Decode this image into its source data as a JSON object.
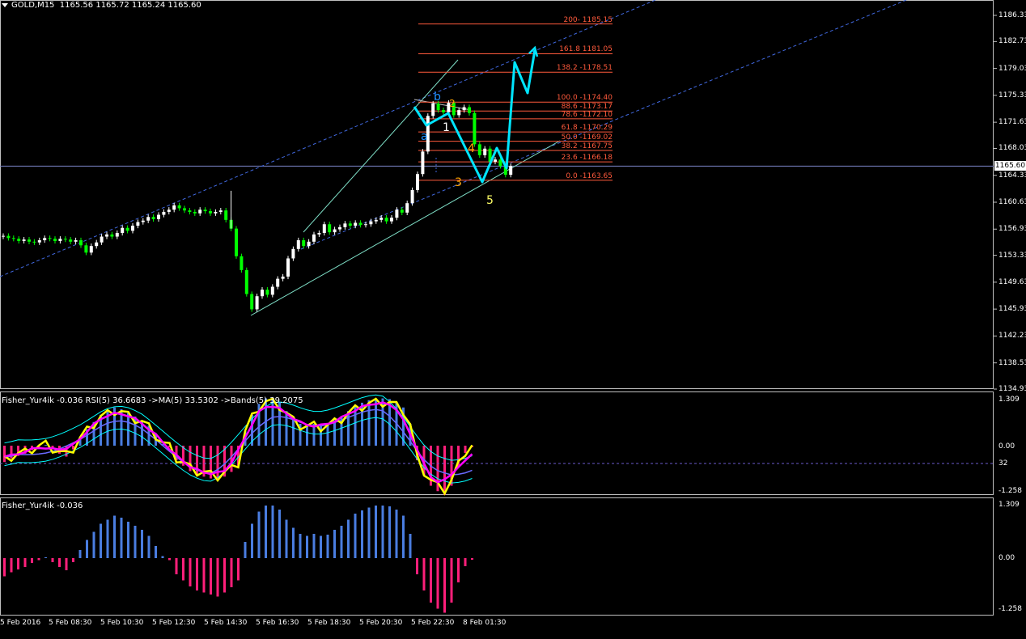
{
  "window": {
    "symbol_label": "GOLD,M15",
    "ohlc_text": "1165.56 1165.72 1165.24 1165.60",
    "dropdown_icon": "triangle-down-icon"
  },
  "colors": {
    "background": "#000000",
    "bull_candle": "#ffffff",
    "bear_candle": "#00ff00",
    "channel_dash": "#4169e1",
    "fib": "#ff5a3c",
    "projection": "#00e5ff",
    "hist_pos": "#4a7de0",
    "hist_neg": "#ff1f7a",
    "rsi": "#ffff00",
    "ma": "#ff00ff",
    "band": "#00ffff"
  },
  "main_chart": {
    "current_price": "1165.60",
    "y_ticks": [
      "1186.33",
      "1182.73",
      "1179.03",
      "1175.33",
      "1171.63",
      "1168.03",
      "1164.33",
      "1160.63",
      "1156.93",
      "1153.33",
      "1149.63",
      "1145.93",
      "1142.23",
      "1138.53",
      "1134.93"
    ],
    "fib_levels": [
      {
        "ratio": "200-",
        "price": "1185.15",
        "text": "200- 1185.15"
      },
      {
        "ratio": "161.8",
        "price": "1181.05",
        "text": "161.8 1181.05"
      },
      {
        "ratio": "138.2",
        "price": "1178.51",
        "text": "138.2 -1178.51"
      },
      {
        "ratio": "100.0",
        "price": "1174.40",
        "text": "100.0 -1174.40"
      },
      {
        "ratio": "88.6",
        "price": "1173.17",
        "text": "88.6 -1173.17"
      },
      {
        "ratio": "78.6",
        "price": "1172.10",
        "text": "78.6 -1172.10"
      },
      {
        "ratio": "61.8",
        "price": "1170.29",
        "text": "61.8 -1170.29"
      },
      {
        "ratio": "50.0",
        "price": "1169.02",
        "text": "50.0 -1169.02"
      },
      {
        "ratio": "38.2",
        "price": "1167.75",
        "text": "38.2 -1167.75"
      },
      {
        "ratio": "23.6",
        "price": "1166.18",
        "text": "23.6 -1166.18"
      },
      {
        "ratio": "0.0",
        "price": "1163.65",
        "text": "0.0 -1163.65"
      }
    ],
    "wave_labels": [
      {
        "text": "b",
        "color": "#1e90ff"
      },
      {
        "text": "2",
        "color": "#ffa500"
      },
      {
        "text": "a",
        "color": "#1e90ff"
      },
      {
        "text": "1",
        "color": "#ffffff"
      },
      {
        "text": "4",
        "color": "#ffa500"
      },
      {
        "text": "3",
        "color": "#ffa500"
      },
      {
        "text": "5",
        "color": "#ffff66"
      }
    ],
    "candles": [
      [
        1155.9,
        1156.0
      ],
      [
        1156.0,
        1155.7
      ],
      [
        1155.7,
        1155.6
      ],
      [
        1155.6,
        1155.3
      ],
      [
        1155.3,
        1155.5
      ],
      [
        1155.5,
        1155.2
      ],
      [
        1155.2,
        1155.1
      ],
      [
        1155.1,
        1155.4
      ],
      [
        1155.4,
        1155.7
      ],
      [
        1155.7,
        1155.6
      ],
      [
        1155.6,
        1155.3
      ],
      [
        1155.3,
        1155.6
      ],
      [
        1155.6,
        1155.5
      ],
      [
        1155.5,
        1155.2
      ],
      [
        1155.2,
        1155.4
      ],
      [
        1155.4,
        1154.7
      ],
      [
        1154.7,
        1153.7
      ],
      [
        1153.7,
        1154.6
      ],
      [
        1154.6,
        1155.1
      ],
      [
        1155.1,
        1155.9
      ],
      [
        1155.9,
        1156.2
      ],
      [
        1156.2,
        1155.9
      ],
      [
        1155.9,
        1156.4
      ],
      [
        1156.4,
        1157.1
      ],
      [
        1157.1,
        1156.7
      ],
      [
        1156.7,
        1157.4
      ],
      [
        1157.4,
        1157.9
      ],
      [
        1157.9,
        1158.1
      ],
      [
        1158.1,
        1158.6
      ],
      [
        1158.6,
        1158.3
      ],
      [
        1158.3,
        1158.9
      ],
      [
        1158.9,
        1159.3
      ],
      [
        1159.3,
        1159.6
      ],
      [
        1159.6,
        1160.2
      ],
      [
        1160.2,
        1159.8
      ],
      [
        1159.8,
        1159.5
      ],
      [
        1159.5,
        1159.3
      ],
      [
        1159.3,
        1159.1
      ],
      [
        1159.1,
        1159.6
      ],
      [
        1159.6,
        1159.4
      ],
      [
        1159.4,
        1159.1
      ],
      [
        1159.1,
        1159.3
      ],
      [
        1159.3,
        1159.5
      ],
      [
        1159.5,
        1158.2
      ],
      [
        1158.2,
        1157.0
      ],
      [
        1157.0,
        1153.2
      ],
      [
        1153.2,
        1151.3
      ],
      [
        1151.3,
        1148.0
      ],
      [
        1148.0,
        1145.9
      ],
      [
        1145.9,
        1147.7
      ],
      [
        1147.7,
        1148.6
      ],
      [
        1148.6,
        1147.9
      ],
      [
        1147.9,
        1149.0
      ],
      [
        1149.0,
        1150.1
      ],
      [
        1150.1,
        1150.4
      ],
      [
        1150.4,
        1152.9
      ],
      [
        1152.9,
        1154.2
      ],
      [
        1154.2,
        1155.4
      ],
      [
        1155.4,
        1154.6
      ],
      [
        1154.6,
        1155.2
      ],
      [
        1155.2,
        1156.2
      ],
      [
        1156.2,
        1156.4
      ],
      [
        1156.4,
        1157.6
      ],
      [
        1157.6,
        1156.5
      ],
      [
        1156.5,
        1156.9
      ],
      [
        1156.9,
        1157.2
      ],
      [
        1157.2,
        1157.7
      ],
      [
        1157.7,
        1157.4
      ],
      [
        1157.4,
        1157.8
      ],
      [
        1157.8,
        1157.5
      ],
      [
        1157.5,
        1157.6
      ],
      [
        1157.6,
        1158.0
      ],
      [
        1158.0,
        1158.2
      ],
      [
        1158.2,
        1158.5
      ],
      [
        1158.5,
        1158.0
      ],
      [
        1158.0,
        1158.5
      ],
      [
        1158.5,
        1159.6
      ],
      [
        1159.6,
        1159.2
      ],
      [
        1159.2,
        1160.5
      ],
      [
        1160.5,
        1162.3
      ],
      [
        1162.3,
        1164.5
      ],
      [
        1164.5,
        1167.6
      ],
      [
        1167.6,
        1172.5
      ],
      [
        1172.5,
        1174.2
      ],
      [
        1174.2,
        1173.3
      ],
      [
        1173.3,
        1173.0
      ],
      [
        1173.0,
        1174.3
      ],
      [
        1174.3,
        1172.6
      ],
      [
        1172.6,
        1173.3
      ],
      [
        1173.3,
        1173.7
      ],
      [
        1173.7,
        1172.9
      ],
      [
        1172.9,
        1168.6
      ],
      [
        1168.6,
        1167.1
      ],
      [
        1167.1,
        1168.0
      ],
      [
        1168.0,
        1166.2
      ],
      [
        1166.2,
        1166.5
      ],
      [
        1166.5,
        1165.6
      ],
      [
        1165.6,
        1164.4
      ],
      [
        1164.4,
        1165.6
      ]
    ],
    "projection": [
      [
        1173.6,
        1171.6
      ],
      [
        1173.6,
        1163.65
      ],
      [
        1170.0,
        1165.0
      ],
      [
        1179.5,
        1176.0
      ],
      [
        1181.05,
        1182.0
      ]
    ]
  },
  "indicator1": {
    "header": "Fisher_Yur4ik -0.036  RSI(5) 36.6683  ->MA(5) 33.5302  ->Bands(5) 39.2075",
    "y_ticks": [
      "1.309",
      "0.00",
      "32",
      "-1.258"
    ]
  },
  "indicator2": {
    "header": "Fisher_Yur4ik -0.036",
    "y_ticks": [
      "1.309",
      "0.00",
      "-1.258"
    ]
  },
  "fisher_values": [
    -0.45,
    -0.35,
    -0.28,
    -0.22,
    -0.12,
    -0.05,
    0.02,
    -0.1,
    -0.22,
    -0.3,
    -0.1,
    0.2,
    0.45,
    0.65,
    0.85,
    0.95,
    1.05,
    1.0,
    0.9,
    0.8,
    0.7,
    0.55,
    0.3,
    0.05,
    -0.05,
    -0.4,
    -0.55,
    -0.7,
    -0.8,
    -0.85,
    -0.9,
    -0.95,
    -0.85,
    -0.72,
    -0.55,
    0.4,
    0.85,
    1.15,
    1.3,
    1.3,
    1.2,
    0.95,
    0.75,
    0.6,
    0.55,
    0.6,
    0.55,
    0.58,
    0.7,
    0.8,
    0.95,
    1.1,
    1.18,
    1.25,
    1.3,
    1.3,
    1.28,
    1.2,
    1.05,
    0.6,
    -0.4,
    -0.8,
    -1.1,
    -1.25,
    -1.35,
    -1.1,
    -0.6,
    -0.2,
    -0.04
  ],
  "x_labels": [
    "5 Feb 2016",
    "5 Feb 08:30",
    "5 Feb 10:30",
    "5 Feb 12:30",
    "5 Feb 14:30",
    "5 Feb 16:30",
    "5 Feb 18:30",
    "5 Feb 20:30",
    "5 Feb 22:30",
    "8 Feb 01:30"
  ]
}
